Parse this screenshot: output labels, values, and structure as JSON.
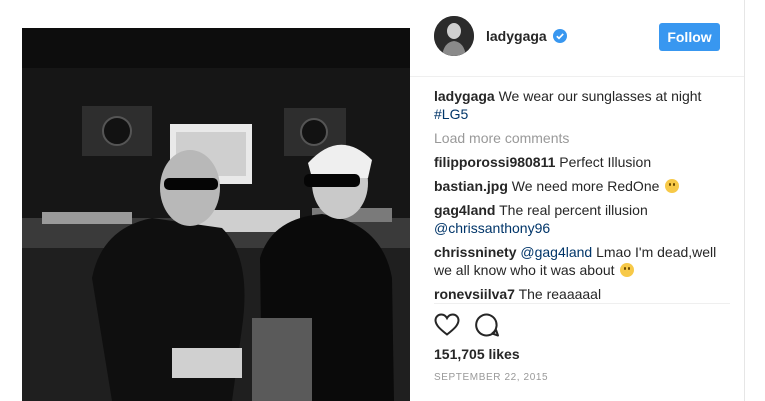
{
  "post": {
    "username": "ladygaga",
    "follow_label": "Follow",
    "comments": [
      {
        "user": "ladygaga",
        "text": "We wear our sunglasses at night",
        "tag": "#LG5"
      }
    ],
    "load_more_label": "Load more comments",
    "more_comments": [
      {
        "user": "filipporossi980811",
        "text": "Perfect Illusion"
      },
      {
        "user": "bastian.jpg",
        "text": "We need more RedOne"
      },
      {
        "user": "gag4land",
        "text": "The real percent illusion",
        "mention": "@chrissanthony96"
      },
      {
        "user": "chrissninety",
        "mention": "@gag4land",
        "text": "Lmao I'm dead,well we all know who it was about"
      },
      {
        "user": "ronevsiilva7",
        "text": "The reaaaaal"
      }
    ],
    "likes": "151,705 likes",
    "date": "SEPTEMBER 22, 2015"
  },
  "colors": {
    "follow_button": "#3897f0",
    "link": "#003569",
    "secondary_text": "#999999"
  },
  "icons": [
    "verified-badge-icon",
    "heart-icon",
    "comment-icon"
  ]
}
